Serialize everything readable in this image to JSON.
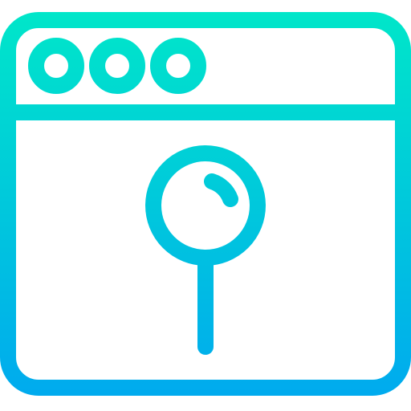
{
  "icon": {
    "name": "browser-window-pin-icon",
    "gradient": {
      "top": "#00E8C8",
      "bottom": "#00A8F0"
    },
    "window_dots": [
      "window-dot",
      "window-dot",
      "window-dot"
    ]
  }
}
